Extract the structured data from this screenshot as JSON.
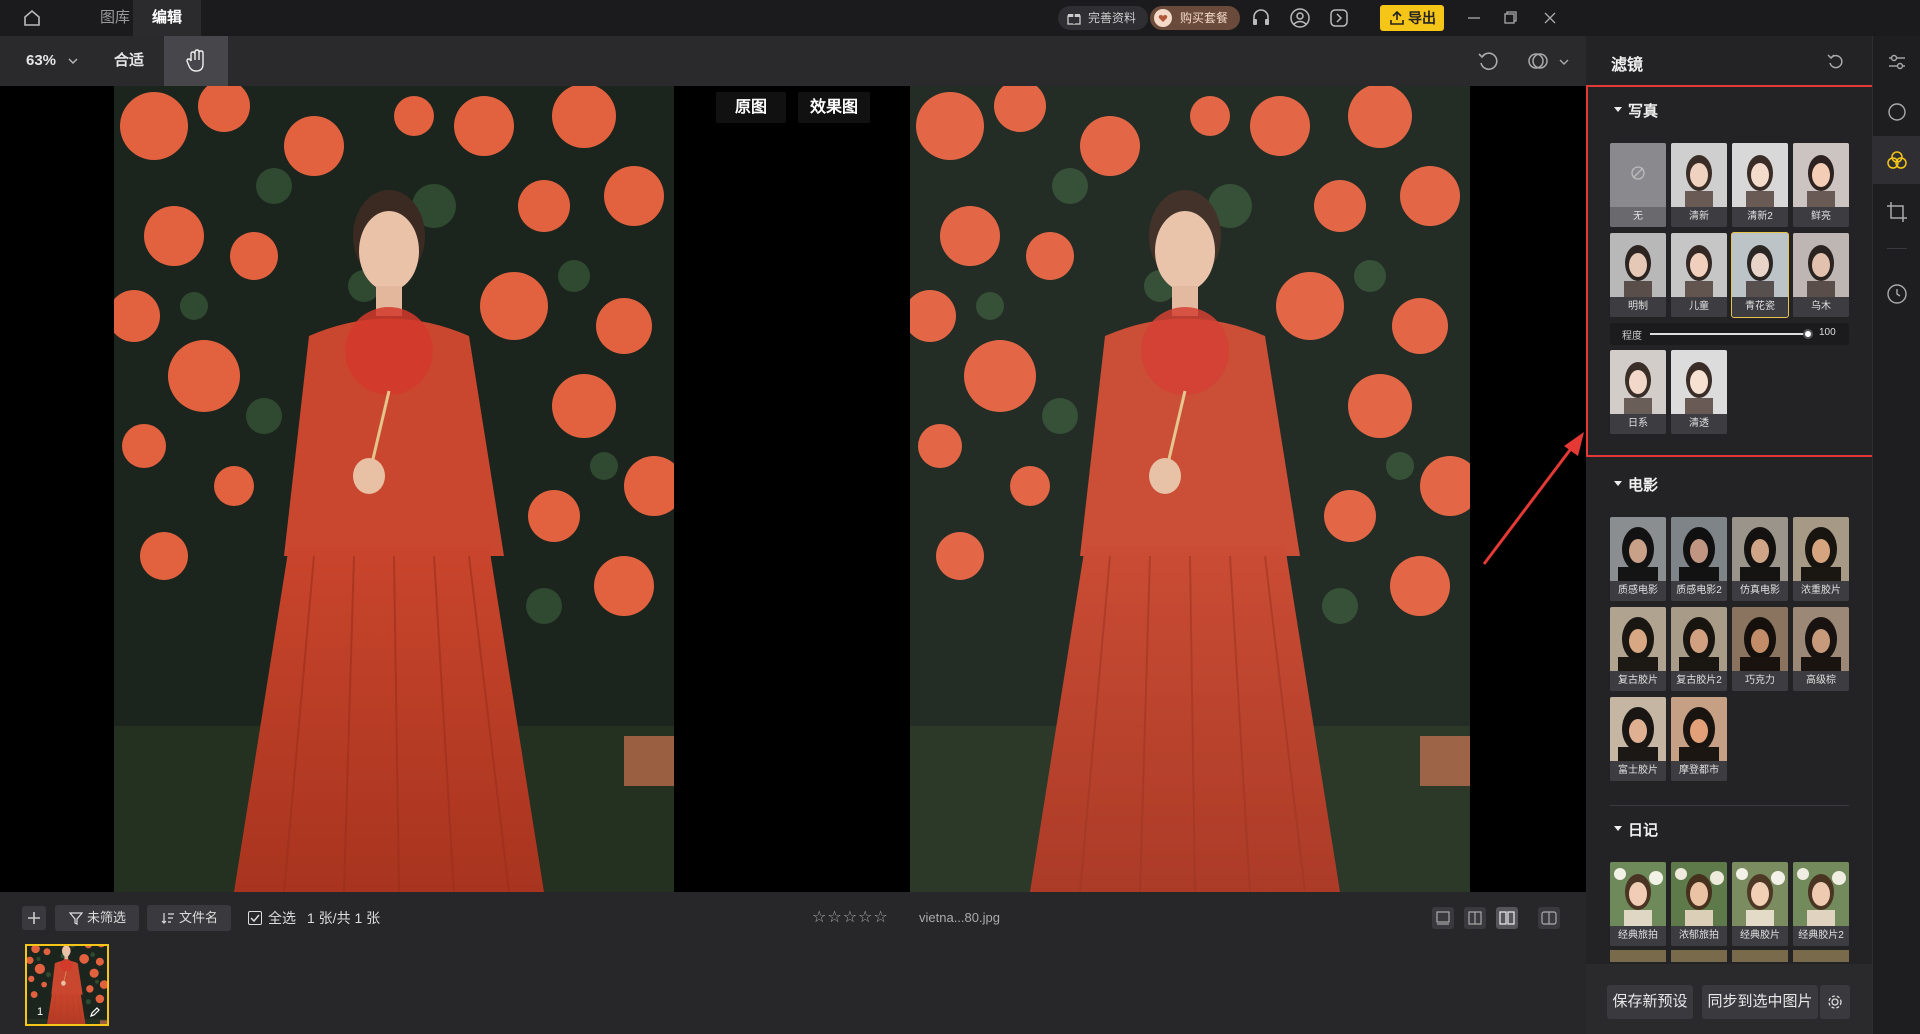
{
  "titlebar": {
    "tabs": [
      {
        "label": "图库",
        "active": false
      },
      {
        "label": "编辑",
        "active": true
      }
    ],
    "complete_profile": "完善资料",
    "buy_package": "购买套餐",
    "export": "导出"
  },
  "toolbar": {
    "zoom": "63%",
    "fit": "合适"
  },
  "canvas": {
    "original_label": "原图",
    "effect_label": "效果图"
  },
  "bottombar": {
    "unfiltered": "未筛选",
    "filename_sort": "文件名",
    "select_all": "全选",
    "count": "1 张/共 1 张",
    "filename": "vietna...80.jpg",
    "thumb_index": "1"
  },
  "panel": {
    "title": "滤镜",
    "sections": [
      {
        "title": "写真",
        "items": [
          "无",
          "清新",
          "清新2",
          "鲜亮",
          "明制",
          "儿童",
          "青花瓷",
          "乌木",
          "日系",
          "清透"
        ],
        "selected": "青花瓷",
        "strength_label": "程度",
        "strength_value": "100",
        "strength_fraction": 1.0
      },
      {
        "title": "电影",
        "items": [
          "质感电影",
          "质感电影2",
          "仿真电影",
          "浓重胶片",
          "复古胶片",
          "复古胶片2",
          "巧克力",
          "高级棕",
          "富士胶片",
          "摩登都市"
        ]
      },
      {
        "title": "日记",
        "items": [
          "经典旅拍",
          "浓郁旅拍",
          "经典胶片",
          "经典胶片2"
        ]
      }
    ],
    "save_preset": "保存新预设",
    "sync_selected": "同步到选中图片"
  },
  "colors": {
    "accent": "#f5c518",
    "highlight": "#e53935",
    "selected_outline": "#e6c34a"
  }
}
